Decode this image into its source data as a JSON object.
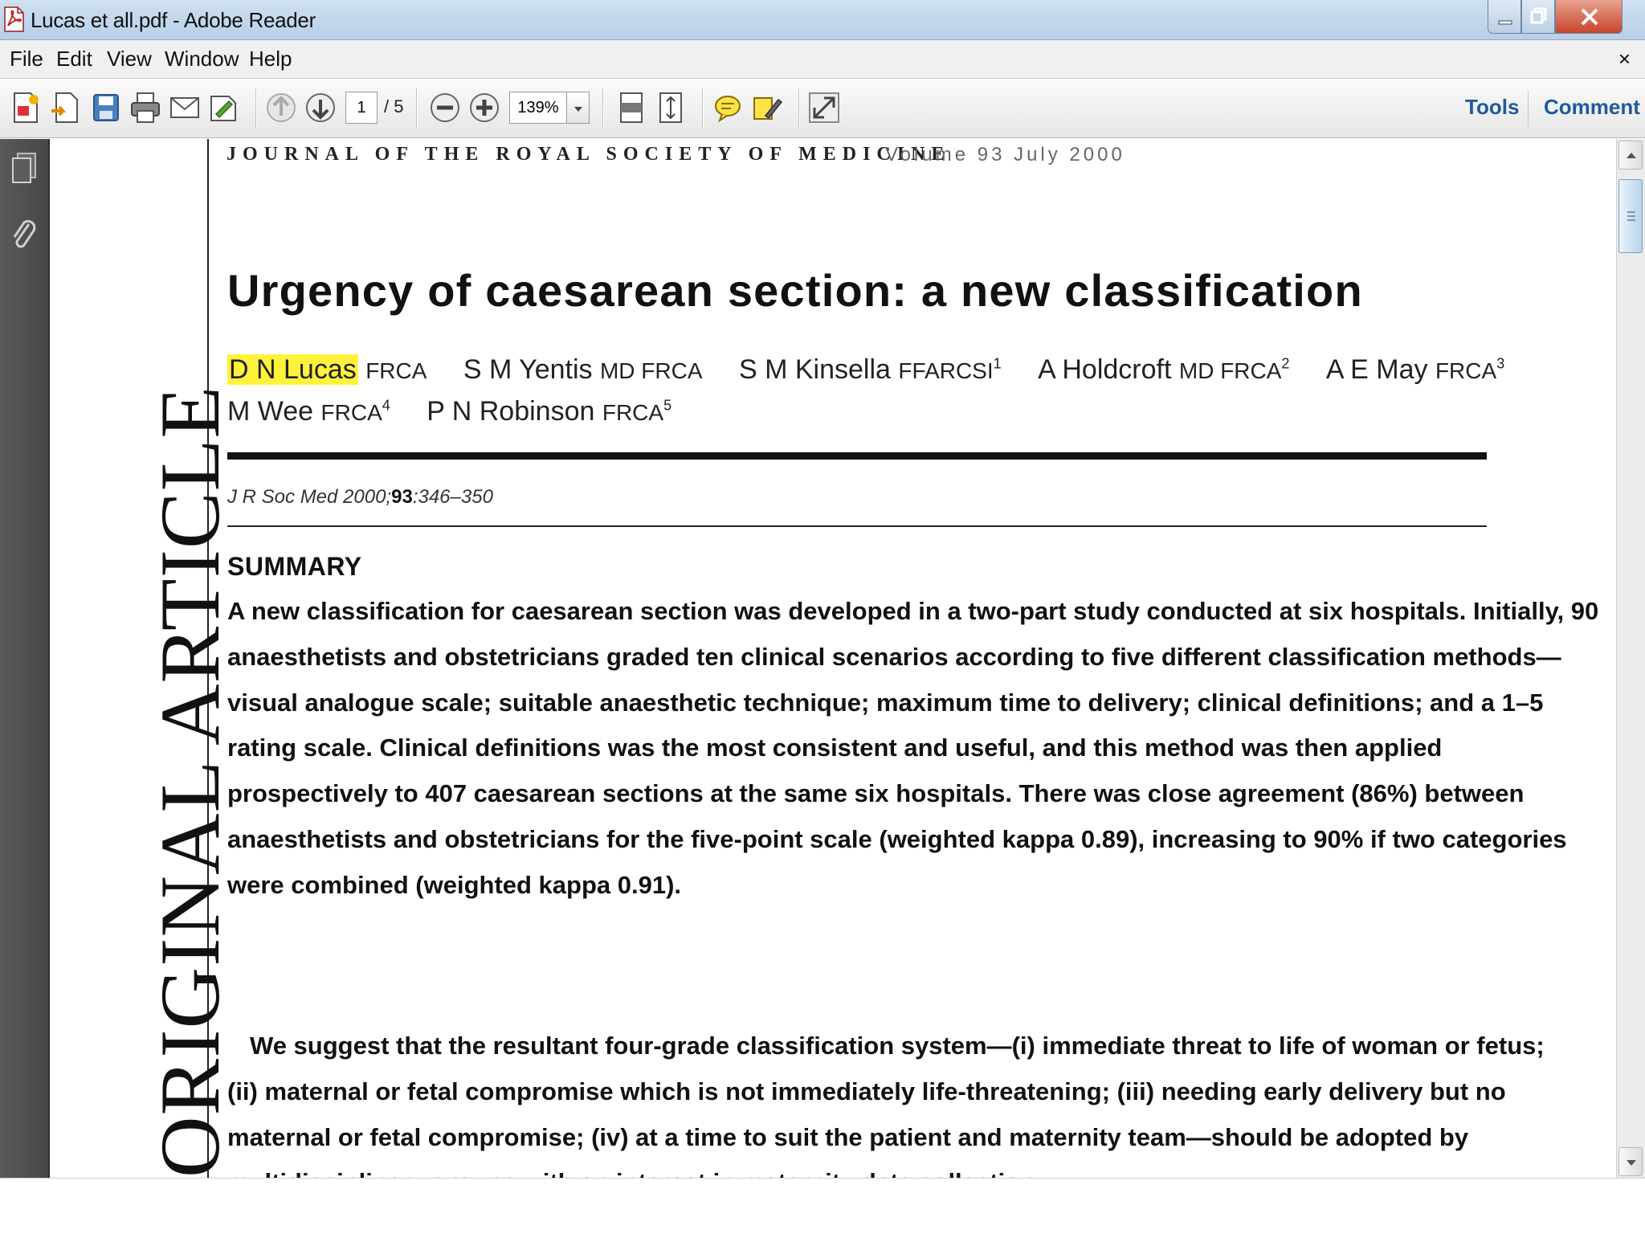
{
  "window": {
    "title": "Lucas et all.pdf - Adobe Reader"
  },
  "menu": {
    "items": [
      "File",
      "Edit",
      "View",
      "Window",
      "Help"
    ],
    "close": "×"
  },
  "toolbar": {
    "current_page": "1",
    "total_pages": "/ 5",
    "zoom": "139%",
    "tools_label": "Tools",
    "comment_label": "Comment"
  },
  "document": {
    "journal": "JOURNAL OF THE ROYAL SOCIETY OF MEDICINE",
    "volume": "Volume 93   July 2000",
    "side_label": "ORIGINAL ARTICLE",
    "title": "Urgency of caesarean section: a new classification",
    "authors_row1": [
      {
        "name": "D N Lucas",
        "degrees": "FRCA",
        "sup": "",
        "highlighted": true
      },
      {
        "name": "S M Yentis",
        "degrees": "MD FRCA",
        "sup": ""
      },
      {
        "name": "S M Kinsella",
        "degrees": "FFARCSI",
        "sup": "1"
      },
      {
        "name": "A Holdcroft",
        "degrees": "MD FRCA",
        "sup": "2"
      },
      {
        "name": "A E May",
        "degrees": "FRCA",
        "sup": "3"
      }
    ],
    "authors_row2": [
      {
        "name": "M Wee",
        "degrees": "FRCA",
        "sup": "4"
      },
      {
        "name": "P N Robinson",
        "degrees": "FRCA",
        "sup": "5"
      }
    ],
    "citation": {
      "prefix": "J R Soc Med 2000;",
      "volume": "93",
      "pages": ":346–350"
    },
    "summary_heading": "SUMMARY",
    "para1_lines": [
      "A new classification for caesarean section was developed in a two-part study conducted at six hospitals. Initially, 90",
      "anaesthetists and obstetricians graded ten clinical scenarios according to five different classification methods—",
      "visual analogue scale; suitable anaesthetic technique; maximum time to delivery; clinical definitions; and a 1–5",
      "rating scale. Clinical definitions was the most consistent and useful, and this method was then applied",
      "prospectively to 407 caesarean sections at the same six hospitals. There was close agreement (86%) between",
      "anaesthetists and obstetricians for the five-point scale (weighted kappa 0.89), increasing to 90% if two categories",
      "were combined (weighted kappa 0.91)."
    ],
    "para2_lines": [
      "We suggest that the resultant four-grade classification system—(i) immediate threat to life of woman or fetus;",
      "(ii) maternal or fetal compromise which is not immediately life-threatening; (iii) needing early delivery but no",
      "maternal or fetal compromise; (iv) at a time to suit the patient and maternity team—should be adopted by",
      "multidisciplinary groups with an interest in maternity data collection."
    ]
  },
  "colors": {
    "highlight": "#fff23c",
    "link": "#1e5a9c",
    "navpane": "#4f4f4f"
  },
  "icons": {
    "toolbar": [
      "create-pdf-icon",
      "open-icon",
      "save-icon",
      "print-icon",
      "email-icon",
      "sign-icon",
      "previous-page-icon",
      "next-page-icon",
      "zoom-out-icon",
      "zoom-in-icon",
      "fit-page-icon",
      "fit-width-icon",
      "sticky-note-icon",
      "highlight-icon",
      "fullscreen-icon"
    ],
    "navpane": [
      "pages-icon",
      "attachment-icon"
    ]
  }
}
